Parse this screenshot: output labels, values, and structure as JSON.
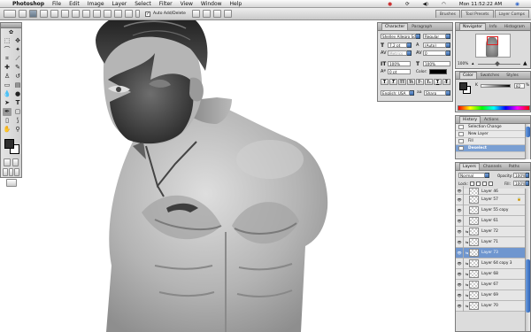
{
  "menubar": {
    "apple": "",
    "app": "Photoshop",
    "items": [
      "File",
      "Edit",
      "Image",
      "Layer",
      "Select",
      "Filter",
      "View",
      "Window",
      "Help"
    ],
    "clock": "Mon 11:52:22 AM"
  },
  "options": {
    "auto_add_delete_checked": true,
    "auto_add_delete_label": "Auto Add/Delete",
    "well_tabs": [
      "Brushes",
      "Tool Presets",
      "Layer Comps"
    ]
  },
  "character": {
    "tabs": [
      "Character",
      "Paragraph"
    ],
    "font_family": "Shelley Allegro Sc...",
    "font_style": "Regular",
    "font_size": "7.2 pt",
    "leading": "(Auto)",
    "kerning": "Metrics",
    "tracking": "0",
    "vscale": "100%",
    "hscale": "100%",
    "baseline": "0 pt",
    "color_label": "Color:",
    "style_buttons": [
      "T",
      "T",
      "TT",
      "Tt",
      "T¹",
      "T₁",
      "T",
      "T̶"
    ],
    "language": "English: USA",
    "antialias": "Sharp"
  },
  "navigator": {
    "tabs": [
      "Navigator",
      "Info",
      "Histogram"
    ],
    "zoom": "100%"
  },
  "color": {
    "tabs": [
      "Color",
      "Swatches",
      "Styles"
    ],
    "channel": "K",
    "value": "82",
    "percent": "%"
  },
  "history": {
    "tabs": [
      "History",
      "Actions"
    ],
    "items": [
      {
        "label": "Selection Change",
        "selected": false
      },
      {
        "label": "New Layer",
        "selected": false
      },
      {
        "label": "Fill",
        "selected": false
      },
      {
        "label": "Deselect",
        "selected": true
      }
    ]
  },
  "layers": {
    "tabs": [
      "Layers",
      "Channels",
      "Paths"
    ],
    "blend_mode": "Normal",
    "opacity_label": "Opacity:",
    "opacity": "100%",
    "lock_label": "Lock:",
    "fill_label": "Fill:",
    "fill": "100%",
    "rows": [
      {
        "name": "Layer 46",
        "selected": false,
        "linked": false,
        "partial": true
      },
      {
        "name": "Layer 57",
        "selected": false,
        "linked": false,
        "locked": true
      },
      {
        "name": "Layer 55 copy",
        "selected": false,
        "linked": false
      },
      {
        "name": "Layer 61",
        "selected": false,
        "linked": false
      },
      {
        "name": "Layer 72",
        "selected": false,
        "linked": true
      },
      {
        "name": "Layer 71",
        "selected": false,
        "linked": true
      },
      {
        "name": "Layer 73",
        "selected": true,
        "linked": true
      },
      {
        "name": "Layer 64 copy 3",
        "selected": false,
        "linked": true
      },
      {
        "name": "Layer 68",
        "selected": false,
        "linked": true
      },
      {
        "name": "Layer 67",
        "selected": false,
        "linked": true
      },
      {
        "name": "Layer 69",
        "selected": false,
        "linked": true
      },
      {
        "name": "Layer 70",
        "selected": false,
        "linked": true
      }
    ]
  },
  "colors": {
    "selection_blue": "#6f96cf",
    "panel_gray": "#dcdcdc",
    "foreground": "#2e2e2e",
    "background": "#ffffff"
  }
}
